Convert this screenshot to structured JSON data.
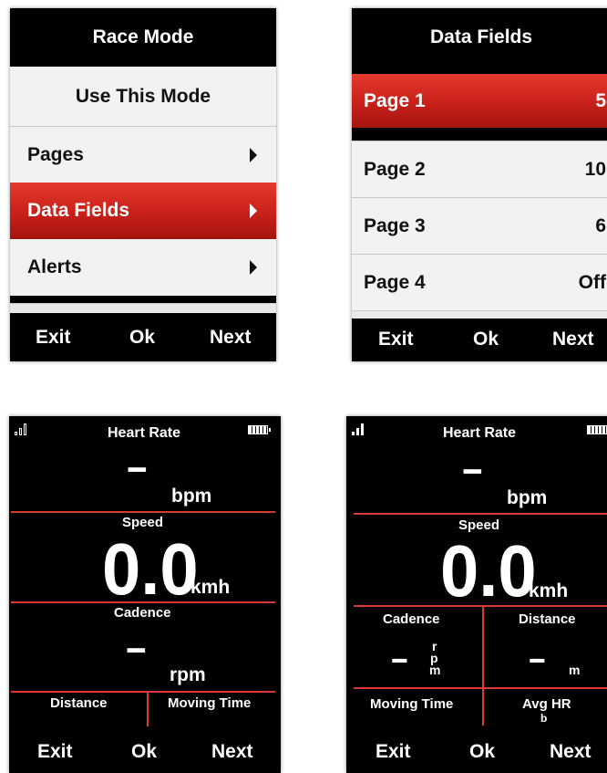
{
  "screen_race_mode": {
    "title": "Race Mode",
    "items": [
      {
        "label": "Use This Mode"
      },
      {
        "label": "Pages"
      },
      {
        "label": "Data Fields",
        "selected": true
      },
      {
        "label": "Alerts"
      }
    ],
    "buttons": {
      "exit": "Exit",
      "ok": "Ok",
      "next": "Next"
    }
  },
  "screen_data_fields": {
    "title": "Data Fields",
    "items": [
      {
        "label": "Page 1",
        "value": "5",
        "selected": true
      },
      {
        "label": "Page 2",
        "value": "10"
      },
      {
        "label": "Page 3",
        "value": "6"
      },
      {
        "label": "Page 4",
        "value": "Off"
      }
    ],
    "buttons": {
      "exit": "Exit",
      "ok": "Ok",
      "next": "Next"
    }
  },
  "screen_data_left": {
    "title": "Heart Rate",
    "heart_rate": {
      "value": "--",
      "unit": "bpm"
    },
    "speed": {
      "label": "Speed",
      "value": "0.0",
      "unit": "kmh"
    },
    "cadence": {
      "label": "Cadence",
      "value": "--",
      "unit": "rpm"
    },
    "distance_label": "Distance",
    "moving_time_label": "Moving Time",
    "buttons": {
      "exit": "Exit",
      "ok": "Ok",
      "next": "Next"
    }
  },
  "screen_data_right": {
    "title": "Heart Rate",
    "heart_rate": {
      "value": "--",
      "unit": "bpm"
    },
    "speed": {
      "label": "Speed",
      "value": "0.0",
      "unit": "kmh"
    },
    "cadence": {
      "label": "Cadence",
      "value": "--",
      "unit_r": "r",
      "unit_p": "p",
      "unit_m": "m"
    },
    "distance": {
      "label": "Distance",
      "value": "--",
      "unit": "m"
    },
    "moving_time_label": "Moving Time",
    "avg_hr": {
      "label": "Avg HR",
      "unit": "b"
    },
    "buttons": {
      "exit": "Exit",
      "ok": "Ok",
      "next": "Next"
    }
  },
  "colors": {
    "accent_red": "#d02a20",
    "screen_bg": "#000000",
    "menu_row_bg": "#f2f2f2"
  },
  "icons": [
    "play-arrow-icon",
    "signal-icon",
    "battery-icon"
  ]
}
